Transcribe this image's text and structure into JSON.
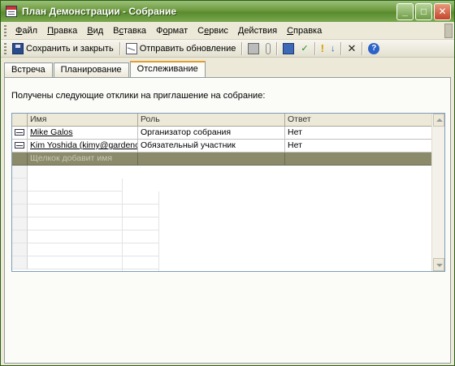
{
  "window": {
    "title": "План Демонстрации - Собрание",
    "buttons": {
      "minimize": "_",
      "maximize": "□",
      "close": "✕"
    }
  },
  "menubar": {
    "items": [
      {
        "pre": "",
        "u": "Ф",
        "post": "айл"
      },
      {
        "pre": "",
        "u": "П",
        "post": "равка"
      },
      {
        "pre": "",
        "u": "В",
        "post": "ид"
      },
      {
        "pre": "В",
        "u": "с",
        "post": "тавка"
      },
      {
        "pre": "Ф",
        "u": "о",
        "post": "рмат"
      },
      {
        "pre": "С",
        "u": "е",
        "post": "рвис"
      },
      {
        "pre": "",
        "u": "Д",
        "post": "ействия"
      },
      {
        "pre": "",
        "u": "С",
        "post": "правка"
      }
    ]
  },
  "toolbar": {
    "save_close": "Сохранить и закрыть",
    "send_update": "Отправить обновление",
    "icons": [
      "floppy-icon",
      "envelope-icon",
      "printer-icon",
      "paperclip-icon",
      "address-book-icon",
      "check-names-icon",
      "importance-high-icon",
      "importance-low-icon",
      "delete-icon",
      "help-icon"
    ]
  },
  "tabs": [
    {
      "label": "Встреча",
      "active": false
    },
    {
      "label": "Планирование",
      "active": false
    },
    {
      "label": "Отслеживание",
      "active": true
    }
  ],
  "tracking": {
    "info": "Получены следующие отклики на приглашение на собрание:",
    "columns": {
      "name": "Имя",
      "role": "Роль",
      "response": "Ответ"
    },
    "rows": [
      {
        "name": "Mike Galos",
        "role": "Организатор собрания",
        "response": "Нет"
      },
      {
        "name": "Kim Yoshida (kimy@gardenco.msn.com)",
        "role": "Обязательный участник",
        "response": "Нет"
      }
    ],
    "new_row_placeholder": "Щелкок добавит имя"
  }
}
